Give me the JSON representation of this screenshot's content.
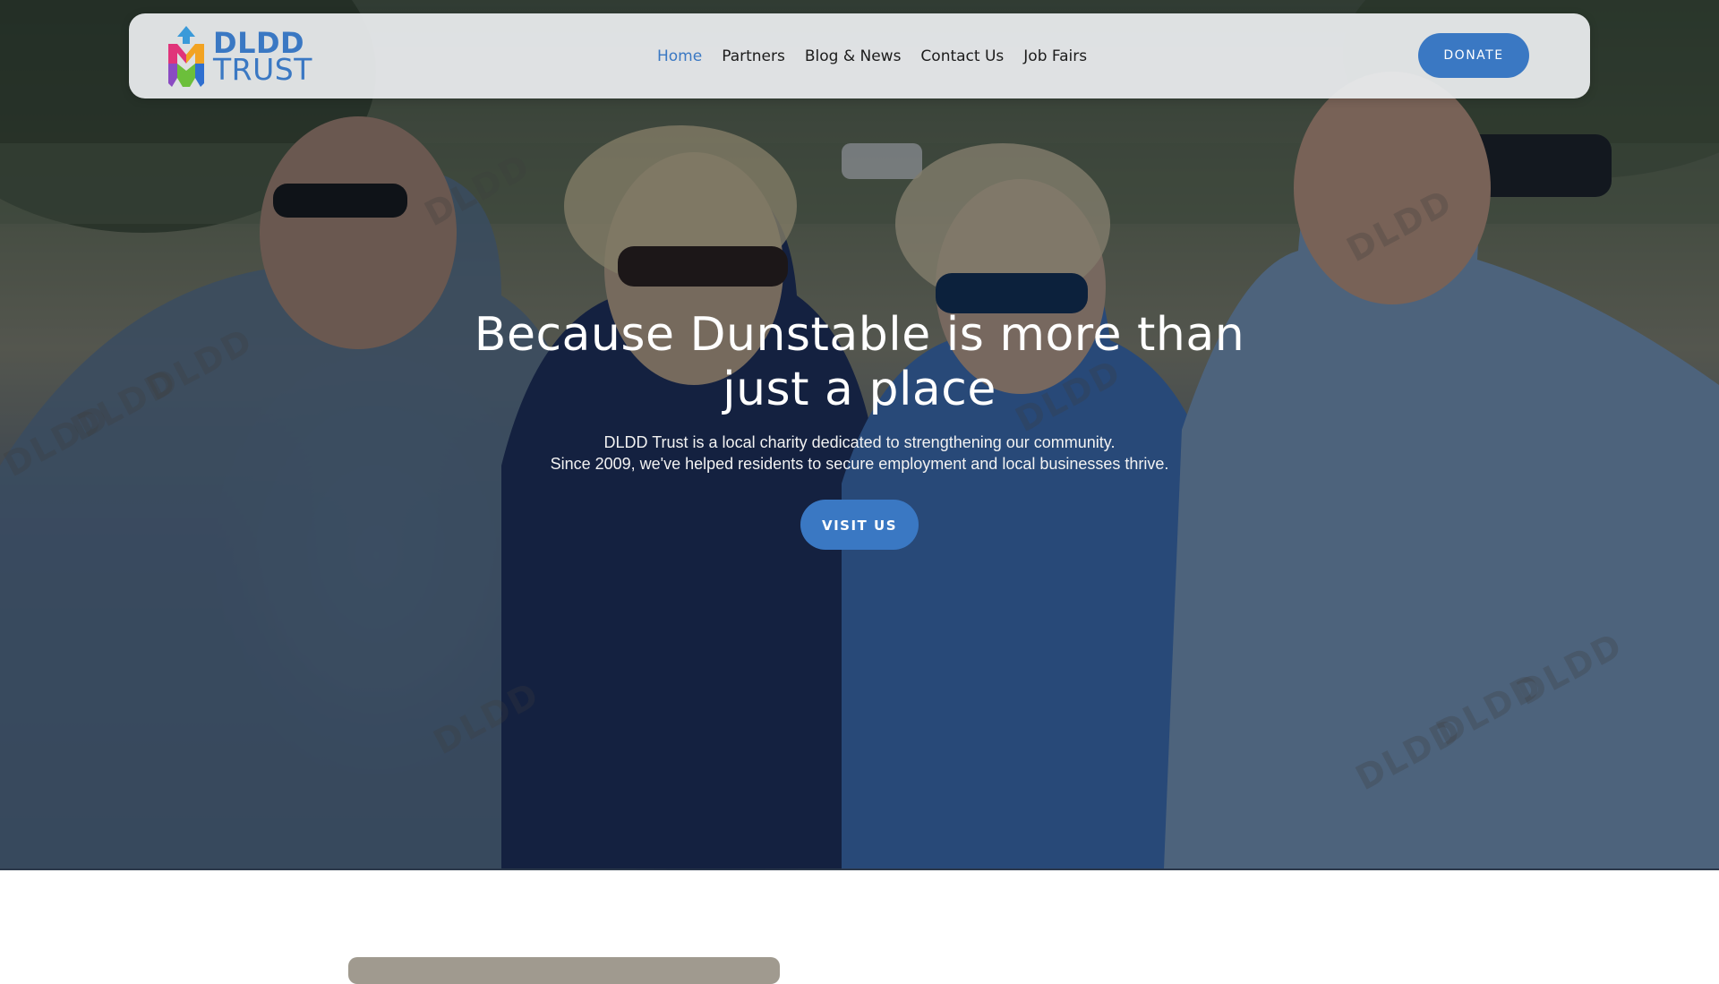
{
  "nav": {
    "logo": {
      "line1": "DLDD",
      "line2": "TRUST"
    },
    "links": [
      {
        "label": "Home",
        "active": true
      },
      {
        "label": "Partners",
        "active": false
      },
      {
        "label": "Blog & News",
        "active": false
      },
      {
        "label": "Contact Us",
        "active": false
      },
      {
        "label": "Job Fairs",
        "active": false
      }
    ],
    "donate_label": "DONATE"
  },
  "hero": {
    "title_line1": "Because Dunstable is more than",
    "title_line2": "just a place",
    "subtitle_line1": "DLDD Trust is a local charity dedicated to strengthening our community.",
    "subtitle_line2": "Since 2009, we've helped residents to secure employment and local businesses thrive.",
    "cta_label": "VISIT US",
    "watermark_text": "DLDD"
  },
  "colors": {
    "brand_blue": "#3a78c3",
    "nav_text": "#1c1c1c",
    "nav_bg": "#eceef0"
  },
  "icons": {
    "logo": "dldd-trust-logo-mark"
  }
}
